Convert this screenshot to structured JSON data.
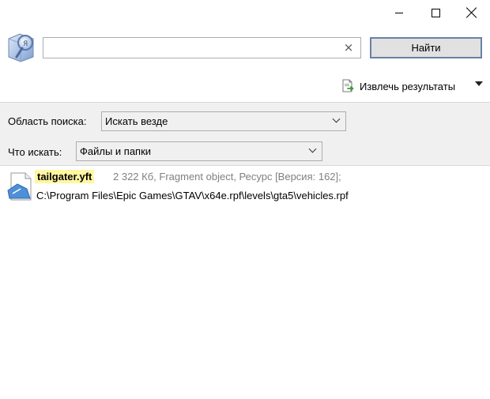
{
  "search": {
    "value": "",
    "clear_glyph": "×",
    "find_label": "Найти"
  },
  "toolbar": {
    "extract_label": "Извлечь результаты",
    "extract_icon": "extract-doc-icon"
  },
  "filters": {
    "scope_label": "Область поиска:",
    "scope_value": "Искать везде",
    "what_label": "Что искать:",
    "what_value": "Файлы и папки"
  },
  "results": [
    {
      "filename": "tailgater.yft",
      "meta": "2 322 Кб, Fragment object, Ресурс [Версия: 162];",
      "path": "C:\\Program Files\\Epic Games\\GTAV\\x64e.rpf\\levels\\gta5\\vehicles.rpf"
    }
  ],
  "colors": {
    "highlight": "#fff8a0",
    "panel_bg": "#f0f0f0",
    "button_border": "#6b7fa8"
  }
}
